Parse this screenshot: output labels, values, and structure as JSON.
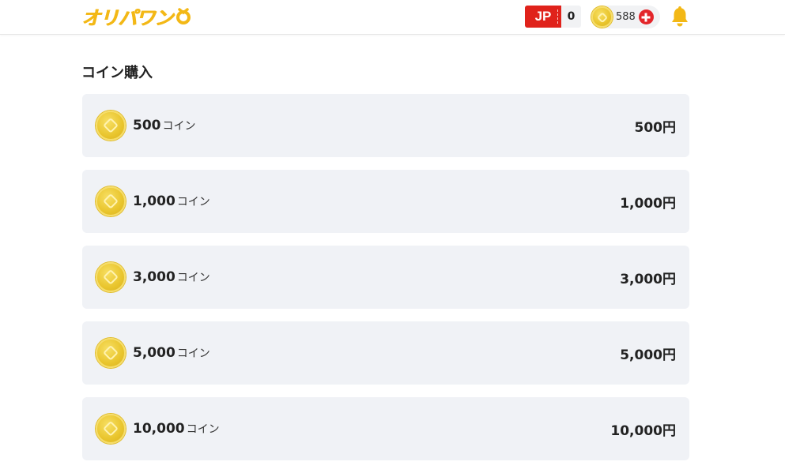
{
  "header": {
    "logo_text": "オリパワン",
    "jp_label": "JP",
    "jp_count": "0",
    "coin_balance": "588"
  },
  "page_title": "コイン購入",
  "coin_unit": "コイン",
  "plans": [
    {
      "amount": "500",
      "price": "500円"
    },
    {
      "amount": "1,000",
      "price": "1,000円"
    },
    {
      "amount": "3,000",
      "price": "3,000円"
    },
    {
      "amount": "5,000",
      "price": "5,000円"
    },
    {
      "amount": "10,000",
      "price": "10,000円"
    }
  ],
  "icons": {
    "logo": "oripa-one-logo",
    "coin": "coin-icon",
    "plus": "plus-icon",
    "bell": "bell-icon"
  },
  "colors": {
    "brand_yellow": "#f3b816",
    "jp_red": "#e0221b",
    "plus_red": "#e3262b",
    "card_bg": "#f0f2f6"
  }
}
